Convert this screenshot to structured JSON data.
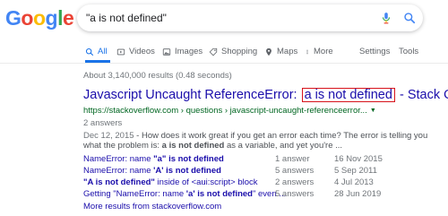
{
  "logo": {
    "letters": [
      "G",
      "o",
      "o",
      "g",
      "l",
      "e"
    ],
    "colors": [
      "#4285F4",
      "#EA4335",
      "#FBBC05",
      "#4285F4",
      "#34A853",
      "#EA4335"
    ]
  },
  "search": {
    "query": "\"a is not defined\""
  },
  "tabs": [
    {
      "label": "All",
      "icon": "search-icon",
      "active": true
    },
    {
      "label": "Videos",
      "icon": "video-icon",
      "active": false
    },
    {
      "label": "Images",
      "icon": "image-icon",
      "active": false
    },
    {
      "label": "Shopping",
      "icon": "tag-icon",
      "active": false
    },
    {
      "label": "Maps",
      "icon": "map-pin-icon",
      "active": false
    },
    {
      "label": "More",
      "icon": "more-dots-icon",
      "active": false
    }
  ],
  "tools": {
    "settings": "Settings",
    "tools": "Tools"
  },
  "result_stats": "About 3,140,000 results (0.48 seconds)",
  "result": {
    "title_prefix": "Javascript Uncaught ReferenceError: ",
    "title_highlight": "a is not defined",
    "title_suffix": " - Stack Ov...",
    "url": "https://stackoverflow.com › questions › javascript-uncaught-referenceerror...",
    "answers": "2 answers",
    "snippet_date": "Dec 12, 2015",
    "snippet_1": " - How does it work great if you get an error each time? The error is telling you what the problem is: ",
    "snippet_bold": "a is not defined",
    "snippet_2": " as a variable, and yet you're ..."
  },
  "sub_results": [
    {
      "pre": "NameError: name ",
      "bold": "\"a\" is not defined",
      "post": "",
      "answers": "1 answer",
      "date": "16 Nov 2015"
    },
    {
      "pre": "NameError: name ",
      "bold": "'A' is not defined",
      "post": "",
      "answers": "5 answers",
      "date": "5 Sep 2011"
    },
    {
      "pre": "",
      "bold": "\"A is not defined\"",
      "post": " inside of <aui:script> block",
      "answers": "2 answers",
      "date": "4 Jul 2013"
    },
    {
      "pre": "Getting \"NameError: name ",
      "bold": "'a' is not defined",
      "post": "\" even ...",
      "answers": "5 answers",
      "date": "28 Jun 2019"
    }
  ],
  "more_results": "More results from stackoverflow.com"
}
